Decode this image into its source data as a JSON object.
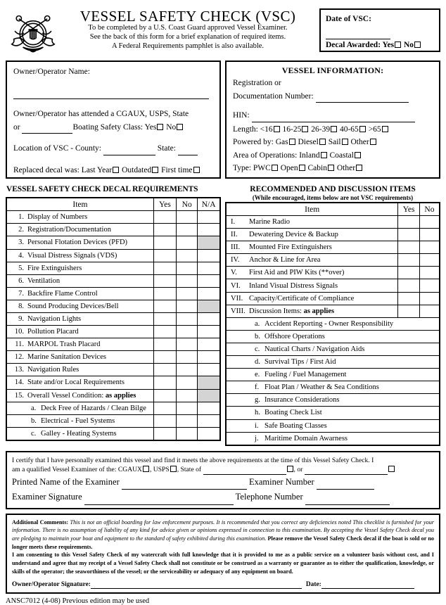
{
  "header": {
    "seal_alt": "us-coast-guard-auxiliary-seal",
    "title": "VESSEL SAFETY CHECK (VSC)",
    "subtitle_1": "To be completed by a U.S. Coast Guard approved Vessel Examiner.",
    "subtitle_2": "See the back of this form for a brief explanation of required items.",
    "subtitle_3": "A Federal Requirements pamphlet is also available.",
    "date_label": "Date of VSC:",
    "decal_label": "Decal Awarded:",
    "yes_label": "Yes",
    "no_label": "No"
  },
  "owner_panel": {
    "name_label": "Owner/Operator Name:",
    "attended_line_1": "Owner/Operator has attended a CGAUX, USPS, State",
    "attended_or": "or",
    "attended_line_2": "Boating Safety Class: Yes",
    "attended_no": "No",
    "location_label": "Location of VSC - County:",
    "state_label": "State:",
    "replaced_label": "Replaced decal was: Last Year",
    "replaced_outdated": "Outdated",
    "replaced_firsttime": "First time"
  },
  "vessel_panel": {
    "title": "VESSEL INFORMATION:",
    "registration_line_1": "Registration or",
    "registration_line_2": "Documentation Number:",
    "hin_label": "HIN:",
    "length_label": "Length:",
    "length_options": [
      "<16",
      "16-25",
      "26-39",
      "40-65",
      ">65"
    ],
    "powered_label": "Powered by:",
    "powered_options": [
      "Gas",
      "Diesel",
      "Sail",
      "Other"
    ],
    "area_label": "Area of Operations:",
    "area_options": [
      "Inland",
      "Coastal"
    ],
    "type_label": "Type:",
    "type_options": [
      "PWC",
      "Open",
      "Cabin",
      "Other"
    ]
  },
  "decal_table": {
    "heading": "VESSEL SAFETY CHECK DECAL REQUIREMENTS",
    "columns": [
      "Item",
      "Yes",
      "No",
      "N/A"
    ],
    "rows": [
      {
        "num": "1.",
        "label": "Display of Numbers",
        "na_shaded": false
      },
      {
        "num": "2.",
        "label": "Registration/Documentation",
        "na_shaded": false
      },
      {
        "num": "3.",
        "label": "Personal Flotation Devices (PFD)",
        "na_shaded": true
      },
      {
        "num": "4.",
        "label": "Visual Distress Signals (VDS)",
        "na_shaded": false
      },
      {
        "num": "5.",
        "label": "Fire Extinguishers",
        "na_shaded": false
      },
      {
        "num": "6.",
        "label": "Ventilation",
        "na_shaded": false
      },
      {
        "num": "7.",
        "label": "Backfire Flame Control",
        "na_shaded": false
      },
      {
        "num": "8.",
        "label": "Sound Producing Devices/Bell",
        "na_shaded": true
      },
      {
        "num": "9.",
        "label": "Navigation Lights",
        "na_shaded": false
      },
      {
        "num": "10.",
        "label": "Pollution Placard",
        "na_shaded": false
      },
      {
        "num": "11.",
        "label": "MARPOL Trash Placard",
        "na_shaded": false
      },
      {
        "num": "12.",
        "label": "Marine Sanitation Devices",
        "na_shaded": false
      },
      {
        "num": "13.",
        "label": "Navigation Rules",
        "na_shaded": false
      },
      {
        "num": "14.",
        "label": "State and/or Local Requirements",
        "na_shaded": true
      },
      {
        "num": "15.",
        "label": "Overall Vessel Condition:",
        "label_bold": "as applies",
        "na_shaded": true
      },
      {
        "num": "a.",
        "label": "Deck Free of Hazards / Clean Bilge",
        "sub": true,
        "na_shaded": false
      },
      {
        "num": "b.",
        "label": "Electrical - Fuel Systems",
        "sub": true,
        "na_shaded": false
      },
      {
        "num": "c.",
        "label": "Galley - Heating Systems",
        "sub": true,
        "na_shaded": false
      }
    ]
  },
  "recommended_table": {
    "heading": "RECOMMENDED AND DISCUSSION ITEMS",
    "subheading": "(While encouraged, items below are not VSC requirements)",
    "columns": [
      "Item",
      "Yes",
      "No"
    ],
    "rows": [
      {
        "num": "I.",
        "label": "Marine Radio",
        "checkcells": true
      },
      {
        "num": "II.",
        "label": "Dewatering Device & Backup",
        "checkcells": true
      },
      {
        "num": "III.",
        "label": "Mounted Fire Extinguishers",
        "checkcells": true
      },
      {
        "num": "IV.",
        "label": "Anchor & Line for Area",
        "checkcells": true
      },
      {
        "num": "V.",
        "label": "First Aid and PIW Kits (**over)",
        "checkcells": true
      },
      {
        "num": "VI.",
        "label": "Inland Visual Distress Signals",
        "checkcells": true
      },
      {
        "num": "VII.",
        "label": "Capacity/Certificate of Compliance",
        "checkcells": true
      },
      {
        "num": "VIII.",
        "label": "Discussion Items:",
        "label_bold": "as applies",
        "checkcells": true
      },
      {
        "num": "a.",
        "label": "Accident Reporting - Owner Responsibility",
        "sub": true,
        "checkcells": false
      },
      {
        "num": "b.",
        "label": "Offshore Operations",
        "sub": true,
        "checkcells": false
      },
      {
        "num": "c.",
        "label": "Nautical Charts / Navigation Aids",
        "sub": true,
        "checkcells": false
      },
      {
        "num": "d.",
        "label": "Survival Tips / First Aid",
        "sub": true,
        "checkcells": false
      },
      {
        "num": "e.",
        "label": "Fueling / Fuel Management",
        "sub": true,
        "checkcells": false
      },
      {
        "num": "f.",
        "label": "Float Plan / Weather & Sea Conditions",
        "sub": true,
        "checkcells": false
      },
      {
        "num": "g.",
        "label": "Insurance Considerations",
        "sub": true,
        "checkcells": false
      },
      {
        "num": "h.",
        "label": "Boating Check List",
        "sub": true,
        "checkcells": false
      },
      {
        "num": "i.",
        "label": "Safe Boating Classes",
        "sub": true,
        "checkcells": false
      },
      {
        "num": "j.",
        "label": "Maritime Domain Awarness",
        "sub": true,
        "checkcells": false
      }
    ]
  },
  "certification": {
    "line_1": "I certify that I have personally examined this vessel and find it meets the above requirements at the time of this Vessel Safety Check.  I",
    "line_2a": "am a qualified Vessel Examiner of the: CGAUX",
    "line_2b": ", USPS",
    "line_2c": ", State of",
    "line_2d": ", or",
    "printed_name_label": "Printed Name of the Examiner",
    "examiner_number_label": "Examiner Number",
    "signature_label": "Examiner Signature",
    "telephone_label": "Telephone Number"
  },
  "legal": {
    "comments_title": "Additional Comments:",
    "comments_body": "This is not an official boarding for law enforcement purposes.  It is recommended that you correct any deficiencies noted  This checklist is furnished for your information.  There is no assumption of liability of any kind for advice given or opinions expressed in connection to this examination.  By accepting the Vessel Safety Check decal you are pledging to maintain your boat and equipment to the standard of safety exhibited during this examination.",
    "comments_bold_tail": "Please remove the Vessel Safety Check decal if the boat is sold or no longer meets these requirements.",
    "consent": "I am consenting to this Vessel Safety Check of my watercraft with full knowledge that it is provided to me as a public service on a volunteer basis without cost, and I understand and agree that my receipt of a Vessel Safety Check shall not constitute or be construed as a warranty or guarantee as to either the qualification, knowledge, or skills of the operator; the seaworthiness of the vessel; or the serviceability or adequacy of any equipment on board.",
    "owner_signature_label": "Owner/Operator Signature:",
    "date_label": "Date:"
  },
  "footer": {
    "form_number": "ANSC7012 (4-08)   Previous edition may be used"
  }
}
